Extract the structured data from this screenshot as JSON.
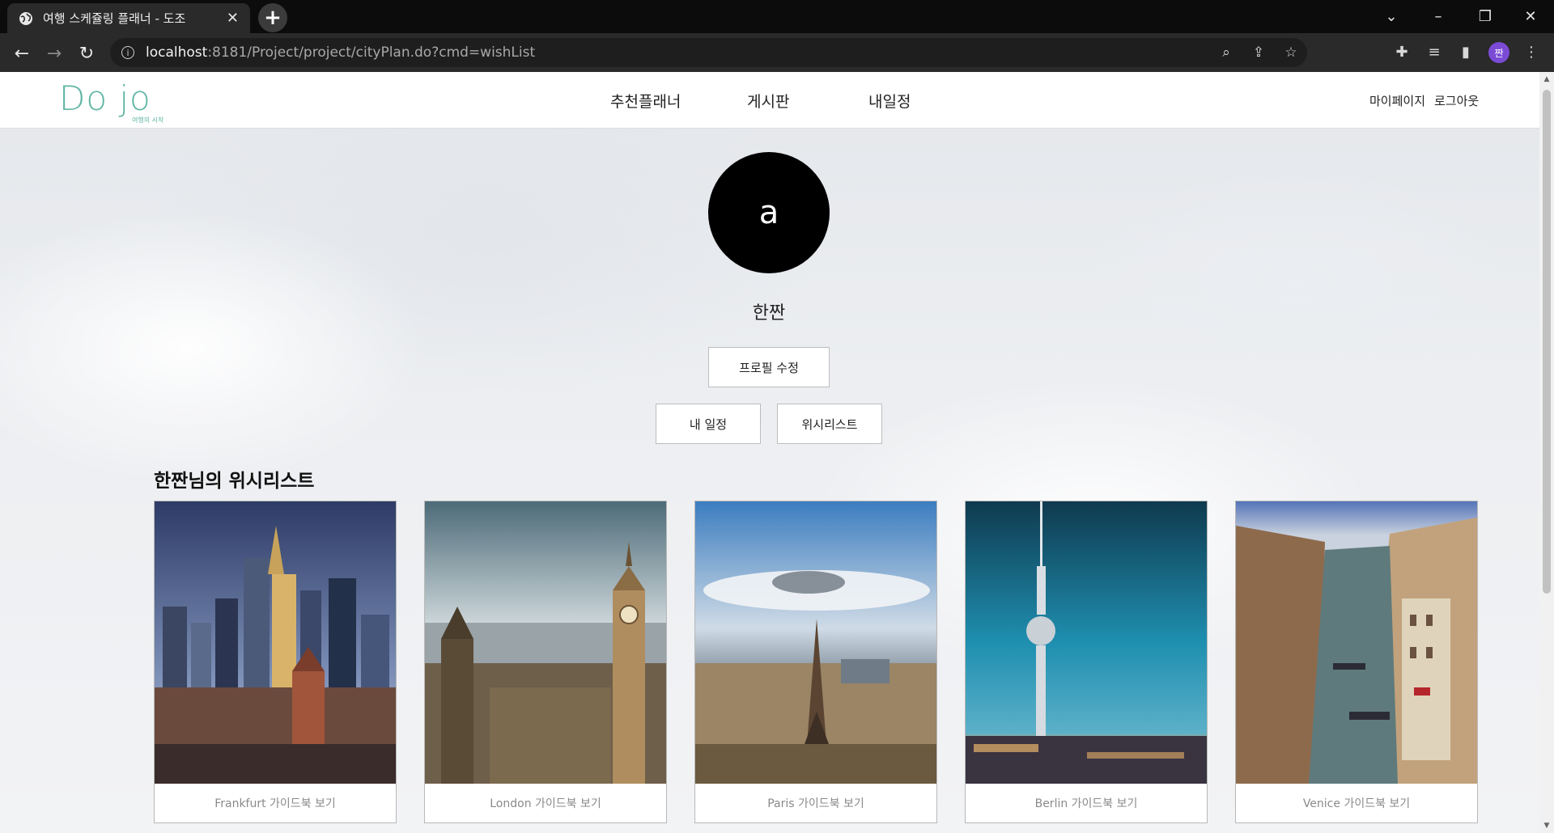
{
  "browser": {
    "tab_title": "여행 스케쥴링 플래너 - 도조",
    "url_host": "localhost",
    "url_path": ":8181/Project/project/cityPlan.do?cmd=wishList",
    "profile_initial": "짠"
  },
  "header": {
    "logo_text": "Do jo",
    "logo_subtext": "여행의 시작",
    "nav": [
      "추천플래너",
      "게시판",
      "내일정"
    ],
    "mypage_label": "마이페이지",
    "logout_label": "로그아웃"
  },
  "profile": {
    "avatar_letter": "a",
    "nickname": "한짠",
    "edit_profile_label": "프로필 수정",
    "my_schedule_label": "내 일정",
    "wishlist_label": "위시리스트"
  },
  "wishlist": {
    "title": "한짠님의 위시리스트",
    "items": [
      {
        "city": "Frankfurt",
        "label": "Frankfurt 가이드북 보기"
      },
      {
        "city": "London",
        "label": "London 가이드북 보기"
      },
      {
        "city": "Paris",
        "label": "Paris 가이드북 보기"
      },
      {
        "city": "Berlin",
        "label": "Berlin 가이드북 보기"
      },
      {
        "city": "Venice",
        "label": "Venice 가이드북 보기"
      }
    ]
  },
  "icons": {
    "globe": "globe-icon",
    "back": "arrow-left-icon",
    "forward": "arrow-right-icon",
    "reload": "reload-icon",
    "zoom": "zoom-icon",
    "share": "share-icon",
    "star": "star-icon",
    "extensions": "puzzle-icon"
  },
  "colors": {
    "brand": "#5fb6a4",
    "avatar_bg": "#000000"
  }
}
